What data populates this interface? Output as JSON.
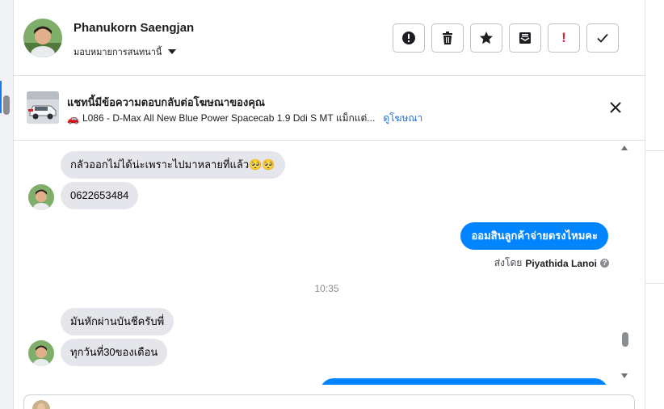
{
  "header": {
    "name": "Phanukorn Saengjan",
    "assign_label": "มอบหมายการสนทนานี้",
    "actions": [
      {
        "icon": "alert-icon",
        "color": "#1c1e21"
      },
      {
        "icon": "trash-icon",
        "color": "#1c1e21"
      },
      {
        "icon": "star-icon",
        "color": "#1c1e21"
      },
      {
        "icon": "archive-icon",
        "color": "#1c1e21"
      },
      {
        "icon": "spam-icon",
        "glyph": "!",
        "color": "#e41e3f"
      },
      {
        "icon": "check-icon",
        "color": "#1c1e21"
      }
    ]
  },
  "ad": {
    "title": "แชทนี้มีข้อความตอบกลับต่อโฆษณาของคุณ",
    "car_glyph": "🚗",
    "description": "L086 - D-Max All New Blue Power Spacecab 1.9 Ddi S MT แม็กแต่...",
    "link": "ดูโฆษณา"
  },
  "messages": {
    "in_1": "กลัวออกไม่ได้น่ะเพราะไปมาหลายที่แล้ว🥺🥺",
    "in_2": "0622653484",
    "out_1": "ออมสินลูกค้าจ่ายตรงไหมคะ",
    "sent_by_prefix": "ส่งโดย",
    "sent_by_name": "Piyathida Lanoi",
    "timestamp": "10:35",
    "in_3": "มันหักผ่านบันชีครับพี่",
    "in_4": "ทุกวันที่30ของเดือน"
  },
  "colors": {
    "outgoing_bubble": "#0084ff",
    "incoming_bubble": "#e4e6eb",
    "link": "#216fdb"
  }
}
